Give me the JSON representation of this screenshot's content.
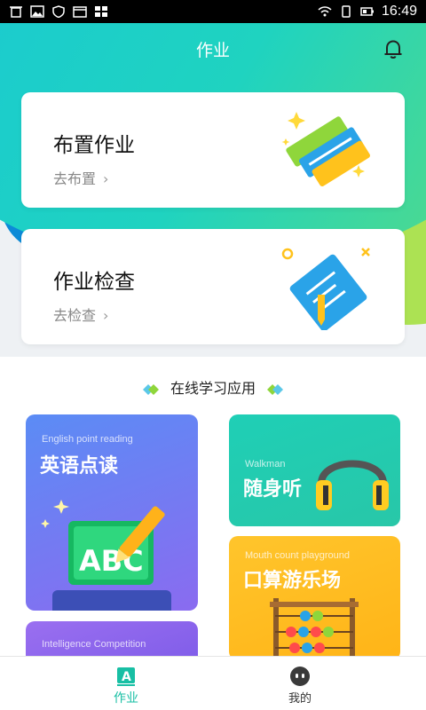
{
  "status_bar": {
    "time": "16:49",
    "icons_left": [
      "trash-icon",
      "image-icon",
      "shield-icon",
      "calendar-icon",
      "grid-icon"
    ],
    "icons_right": [
      "wifi-icon",
      "sim-icon",
      "battery-icon"
    ]
  },
  "header": {
    "title": "作业",
    "bell_icon": "bell-icon"
  },
  "cards": [
    {
      "title": "布置作业",
      "link": "去布置",
      "chevron": "›"
    },
    {
      "title": "作业检查",
      "link": "去检查",
      "chevron": "›"
    }
  ],
  "section": {
    "title": "在线学习应用"
  },
  "tiles": {
    "english": {
      "en": "English point reading",
      "zh": "英语点读",
      "art_text": "ABC"
    },
    "walkman": {
      "en": "Walkman",
      "zh": "随身听"
    },
    "mouth": {
      "en": "Mouth count playground",
      "zh": "口算游乐场"
    },
    "intel": {
      "en": "Intelligence Competition"
    }
  },
  "tabbar": [
    {
      "label": "作业",
      "icon": "A",
      "active": true
    },
    {
      "label": "我的",
      "active": false
    }
  ],
  "colors": {
    "accent": "#18bfa4",
    "cyan": "#18c6d9",
    "green": "#a8e04a"
  }
}
